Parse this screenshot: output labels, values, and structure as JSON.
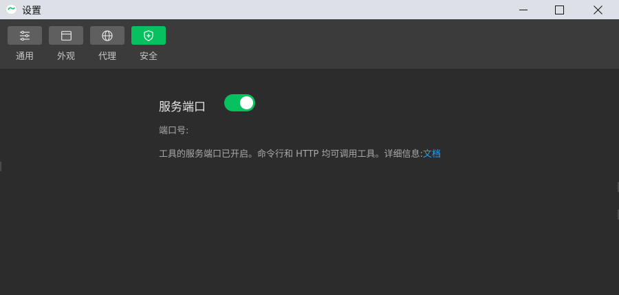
{
  "window": {
    "title": "设置"
  },
  "toolbar": {
    "items": [
      {
        "label": "通用",
        "icon": "sliders-icon"
      },
      {
        "label": "外观",
        "icon": "window-icon"
      },
      {
        "label": "代理",
        "icon": "globe-icon"
      },
      {
        "label": "安全",
        "icon": "shield-icon",
        "active": true
      }
    ]
  },
  "security": {
    "service_port_label": "服务端口",
    "service_port_enabled": true,
    "port_number_label": "端口号:",
    "description": "工具的服务端口已开启。命令行和 HTTP 均可调用工具。详细信息:",
    "doc_link_label": "文档"
  },
  "colors": {
    "accent": "#07c160",
    "link": "#2d9be8",
    "background": "#2c2c2c",
    "toolbar": "#3b3b3b",
    "titlebar": "#dde1e7"
  }
}
